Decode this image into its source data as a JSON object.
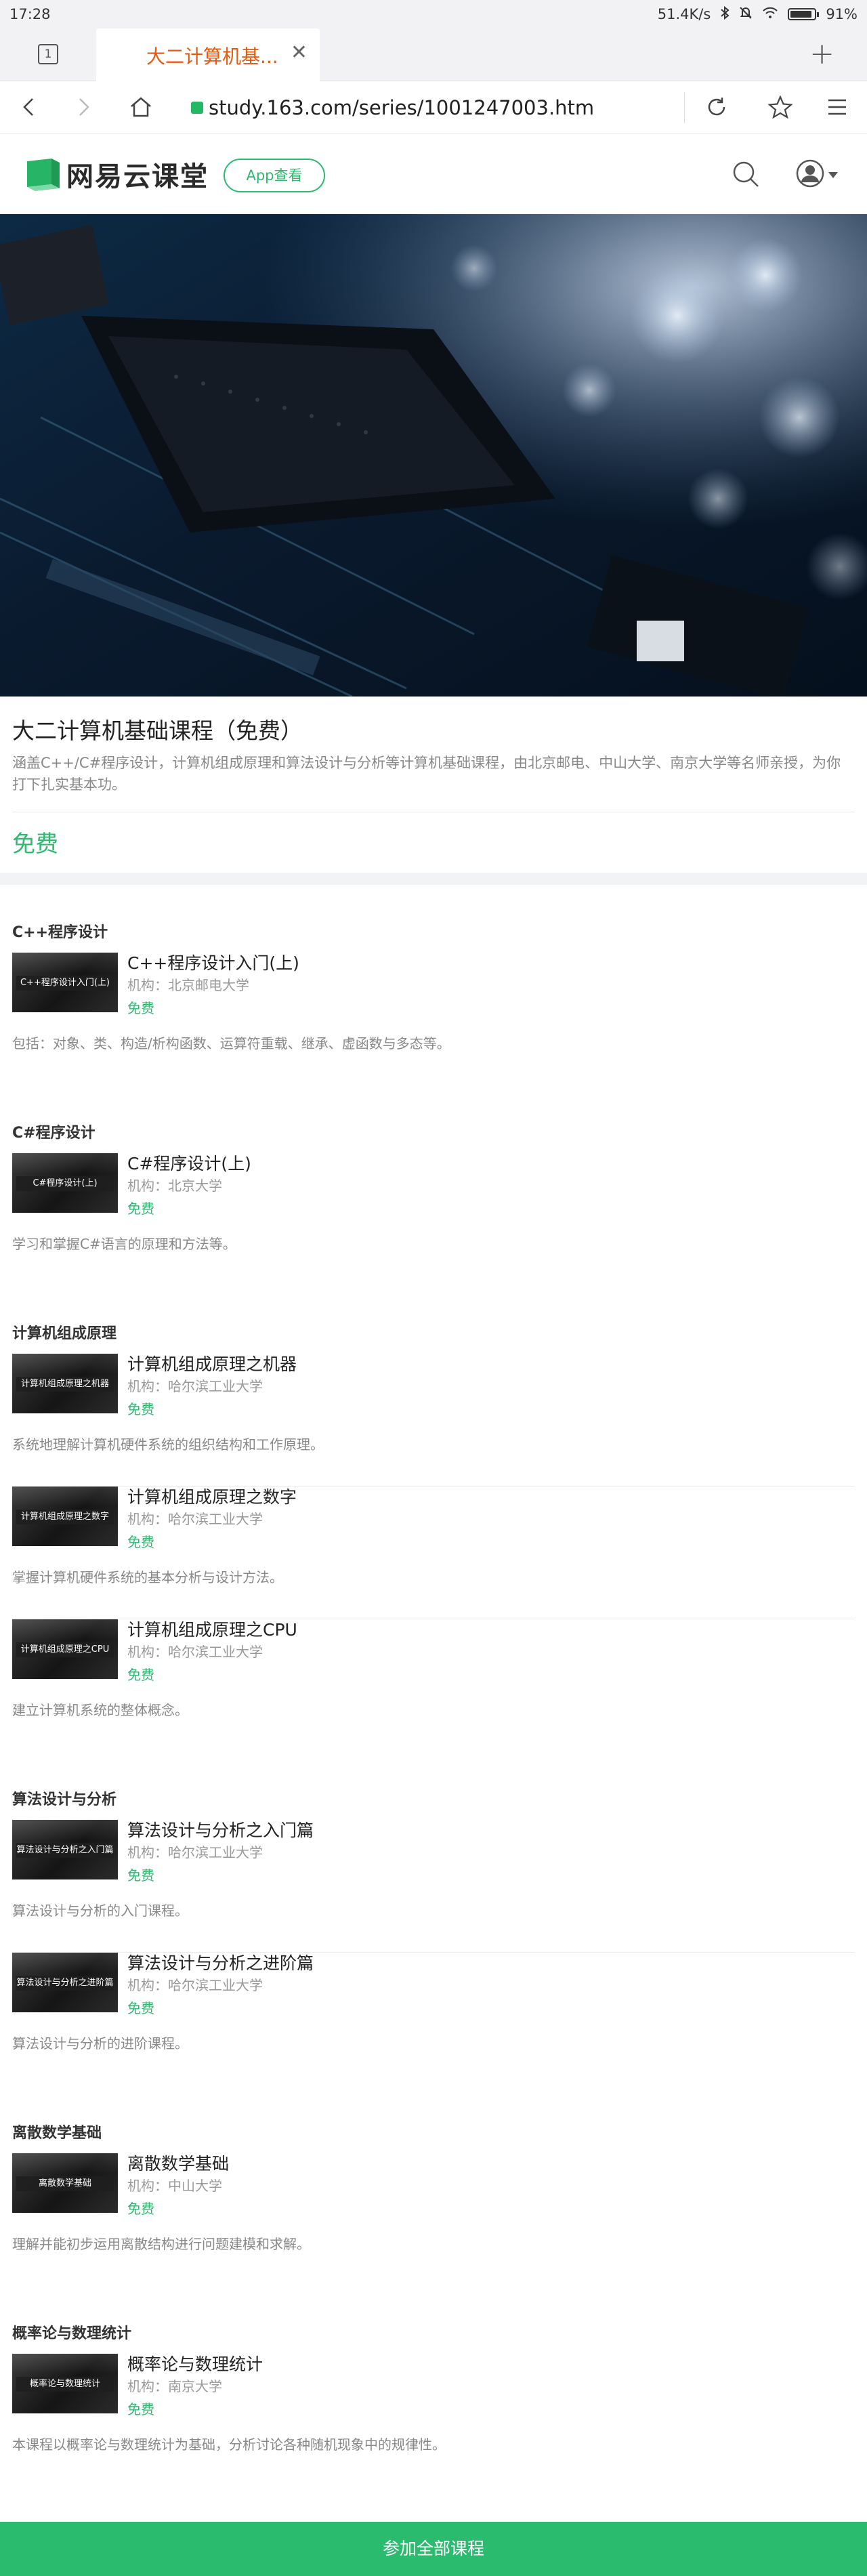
{
  "status_bar": {
    "time": "17:28",
    "net_speed": "51.4K/s",
    "battery_percent": "91%",
    "battery_level": 0.91
  },
  "browser": {
    "tab_count": "1",
    "tab_title": "大二计算机基...",
    "url": "study.163.com/series/1001247003.htm"
  },
  "site_header": {
    "logo_text": "网易云课堂",
    "app_button": "App查看"
  },
  "course": {
    "title": "大二计算机基础课程（免费）",
    "description": "涵盖C++/C#程序设计，计算机组成原理和算法设计与分析等计算机基础课程，由北京邮电、中山大学、南京大学等名师亲授，为你打下扎实基本功。",
    "price": "免费"
  },
  "sections": [
    {
      "title": "C++程序设计",
      "items": [
        {
          "thumb_label": "C++程序设计入门(上)",
          "name": "C++程序设计入门(上)",
          "org": "机构：北京邮电大学",
          "price": "免费",
          "desc": "包括：对象、类、构造/析构函数、运算符重载、继承、虚函数与多态等。"
        }
      ]
    },
    {
      "title": "C#程序设计",
      "items": [
        {
          "thumb_label": "C#程序设计(上)",
          "name": "C#程序设计(上)",
          "org": "机构：北京大学",
          "price": "免费",
          "desc": "学习和掌握C#语言的原理和方法等。"
        }
      ]
    },
    {
      "title": "计算机组成原理",
      "items": [
        {
          "thumb_label": "计算机组成原理之机器",
          "name": "计算机组成原理之机器",
          "org": "机构：哈尔滨工业大学",
          "price": "免费",
          "desc": "系统地理解计算机硬件系统的组织结构和工作原理。"
        },
        {
          "thumb_label": "计算机组成原理之数字",
          "name": "计算机组成原理之数字",
          "org": "机构：哈尔滨工业大学",
          "price": "免费",
          "desc": "掌握计算机硬件系统的基本分析与设计方法。"
        },
        {
          "thumb_label": "计算机组成原理之CPU",
          "name": "计算机组成原理之CPU",
          "org": "机构：哈尔滨工业大学",
          "price": "免费",
          "desc": "建立计算机系统的整体概念。"
        }
      ]
    },
    {
      "title": "算法设计与分析",
      "items": [
        {
          "thumb_label": "算法设计与分析之入门篇",
          "name": "算法设计与分析之入门篇",
          "org": "机构：哈尔滨工业大学",
          "price": "免费",
          "desc": "算法设计与分析的入门课程。"
        },
        {
          "thumb_label": "算法设计与分析之进阶篇",
          "name": "算法设计与分析之进阶篇",
          "org": "机构：哈尔滨工业大学",
          "price": "免费",
          "desc": "算法设计与分析的进阶课程。"
        }
      ]
    },
    {
      "title": "离散数学基础",
      "items": [
        {
          "thumb_label": "离散数学基础",
          "name": "离散数学基础",
          "org": "机构：中山大学",
          "price": "免费",
          "desc": "理解并能初步运用离散结构进行问题建模和求解。"
        }
      ]
    },
    {
      "title": "概率论与数理统计",
      "items": [
        {
          "thumb_label": "概率论与数理统计",
          "name": "概率论与数理统计",
          "org": "机构：南京大学",
          "price": "免费",
          "desc": "本课程以概率论与数理统计为基础，分析讨论各种随机现象中的规律性。"
        }
      ]
    }
  ],
  "join_button": "参加全部课程",
  "colors": {
    "accent_green": "#2bbb6f",
    "tab_title_orange": "#e8590c"
  },
  "icons": [
    "wifi-icon",
    "bluetooth-icon",
    "mute-icon",
    "battery-icon",
    "back-icon",
    "forward-icon",
    "home-icon",
    "refresh-icon",
    "star-icon",
    "menu-icon",
    "search-icon",
    "user-icon",
    "chevron-down-icon",
    "close-icon",
    "add-tab-icon"
  ]
}
